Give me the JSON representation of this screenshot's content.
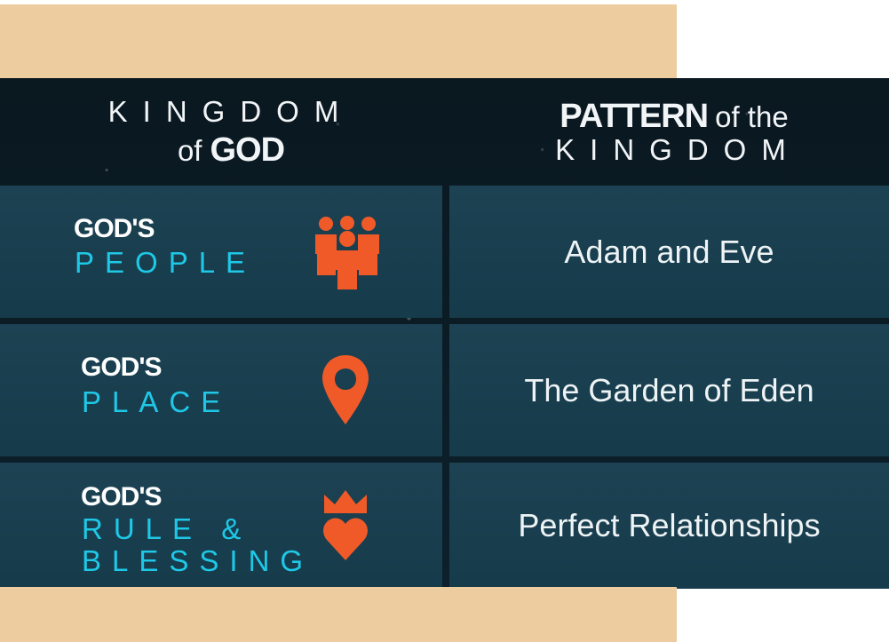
{
  "header": {
    "left": {
      "line1": "KINGDOM",
      "line2_prefix": "of",
      "line2_bold": "GOD"
    },
    "right": {
      "line1_bold": "PATTERN",
      "line1_rest": "of the",
      "line2": "KINGDOM"
    }
  },
  "rows": [
    {
      "god_label": "GOD'S",
      "topic": "PEOPLE",
      "icon": "people-icon",
      "pattern": "Adam and Eve"
    },
    {
      "god_label": "GOD'S",
      "topic": "PLACE",
      "icon": "location-pin-icon",
      "pattern": "The Garden of Eden"
    },
    {
      "god_label": "GOD'S",
      "topic": "RULE &\nBLESSING",
      "icon": "crown-heart-icon",
      "pattern": "Perfect Relationships"
    }
  ],
  "colors": {
    "beige": "#edcc9f",
    "panel_dark": "#0b1c26",
    "cell_teal": "#173e4f",
    "accent_cyan": "#1ec8e6",
    "icon_orange": "#f05a28",
    "text_white": "#ffffff"
  }
}
